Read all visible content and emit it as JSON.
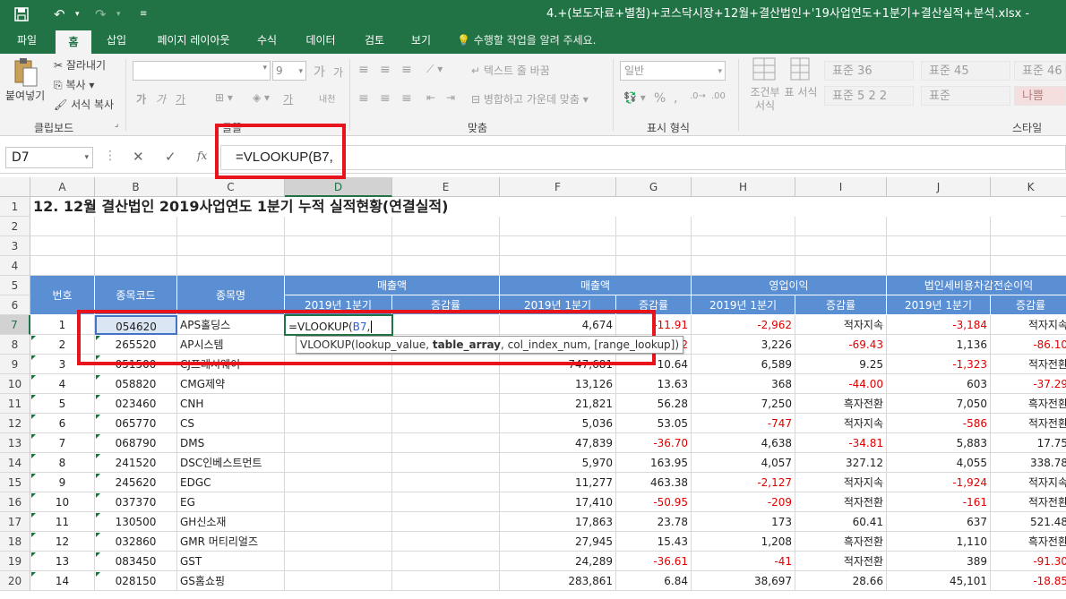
{
  "titlebar": {
    "save_icon": "save-icon",
    "undo_icon": "undo-icon",
    "redo_icon": "redo-icon",
    "customize_icon": "customize-qat-icon",
    "file_title": "4.+(보도자료+별첨)+코스닥시장+12월+결산법인+'19사업연도+1분기+결산실적+분석.xlsx -"
  },
  "tabs": [
    "파일",
    "홈",
    "삽입",
    "페이지 레이아웃",
    "수식",
    "데이터",
    "검토",
    "보기"
  ],
  "tell_me": "수행할 작업을 알려 주세요.",
  "ribbon": {
    "paste": "붙여넣기",
    "cut": "잘라내기",
    "copy": "복사",
    "format_painter": "서식 복사",
    "clipboard_group": "클립보드",
    "font_group": "글꼴",
    "font_size": "9",
    "bold": "가",
    "italic": "가",
    "underline": "가",
    "increase_font": "가",
    "decrease_font": "가",
    "font_color": "가",
    "phonetic": "내천",
    "wrap_text": "텍스트 줄 바꿈",
    "merge_center": "병합하고 가운데 맞춤",
    "alignment_group": "맞춤",
    "number_format": "일반",
    "percent": "%",
    "comma": ",",
    "number_group": "표시 형식",
    "conditional": "조건부 서식",
    "format_as_table": "표 서식",
    "styles": [
      "표준 36",
      "표준 45",
      "표준 46",
      "표준 5 2 2",
      "표준",
      "나쁨"
    ],
    "styles_group": "스타일"
  },
  "formula_bar": {
    "name_box": "D7",
    "cancel": "✕",
    "enter": "✓",
    "fx": "fx",
    "formula": "=VLOOKUP(B7,"
  },
  "columns": [
    "A",
    "B",
    "C",
    "D",
    "E",
    "F",
    "G",
    "H",
    "I",
    "J",
    "K"
  ],
  "row_numbers": [
    "1",
    "2",
    "3",
    "4",
    "5",
    "6",
    "7",
    "8",
    "9",
    "10",
    "11",
    "12",
    "13",
    "14",
    "15",
    "16",
    "17",
    "18",
    "19",
    "20"
  ],
  "sheet_title": "12. 12월 결산법인 2019사업연도 1분기 누적 실적현황(연결실적)",
  "headers": {
    "no": "번호",
    "code": "종목코드",
    "name": "종목명",
    "sales_d": "매출액",
    "sales_f": "매출액",
    "op_income": "영업이익",
    "net_income": "법인세비용차감전순이익",
    "q1_2019_d": "2019년 1분기",
    "change_e": "증감률",
    "q1_2019_f": "2019년 1분기",
    "change_g": "증감률",
    "q1_2019_h": "2019년 1분기",
    "change_i": "증감률",
    "q1_2019_j": "2019년 1분기",
    "change_k": "증감률"
  },
  "rows": [
    {
      "no": "1",
      "code": "054620",
      "name": "APS홀딩스",
      "sales": "4,674",
      "sales_chg": "-11.91",
      "op": "-2,962",
      "op_chg": "적자지속",
      "net": "-3,184",
      "net_chg": "적자지속"
    },
    {
      "no": "2",
      "code": "265520",
      "name": "AP시스템",
      "sales": "",
      "sales_chg": "-40.82",
      "op": "3,226",
      "op_chg": "-69.43",
      "net": "1,136",
      "net_chg": "-86.10"
    },
    {
      "no": "3",
      "code": "051500",
      "name": "CJ프레시웨이",
      "sales": "747,681",
      "sales_chg": "10.64",
      "op": "6,589",
      "op_chg": "9.25",
      "net": "-1,323",
      "net_chg": "적자전환"
    },
    {
      "no": "4",
      "code": "058820",
      "name": "CMG제약",
      "sales": "13,126",
      "sales_chg": "13.63",
      "op": "368",
      "op_chg": "-44.00",
      "net": "603",
      "net_chg": "-37.29"
    },
    {
      "no": "5",
      "code": "023460",
      "name": "CNH",
      "sales": "21,821",
      "sales_chg": "56.28",
      "op": "7,250",
      "op_chg": "흑자전환",
      "net": "7,050",
      "net_chg": "흑자전환"
    },
    {
      "no": "6",
      "code": "065770",
      "name": "CS",
      "sales": "5,036",
      "sales_chg": "53.05",
      "op": "-747",
      "op_chg": "적자지속",
      "net": "-586",
      "net_chg": "적자전환"
    },
    {
      "no": "7",
      "code": "068790",
      "name": "DMS",
      "sales": "47,839",
      "sales_chg": "-36.70",
      "op": "4,638",
      "op_chg": "-34.81",
      "net": "5,883",
      "net_chg": "17.75"
    },
    {
      "no": "8",
      "code": "241520",
      "name": "DSC인베스트먼트",
      "sales": "5,970",
      "sales_chg": "163.95",
      "op": "4,057",
      "op_chg": "327.12",
      "net": "4,055",
      "net_chg": "338.78"
    },
    {
      "no": "9",
      "code": "245620",
      "name": "EDGC",
      "sales": "11,277",
      "sales_chg": "463.38",
      "op": "-2,127",
      "op_chg": "적자지속",
      "net": "-1,924",
      "net_chg": "적자지속"
    },
    {
      "no": "10",
      "code": "037370",
      "name": "EG",
      "sales": "17,410",
      "sales_chg": "-50.95",
      "op": "-209",
      "op_chg": "적자전환",
      "net": "-161",
      "net_chg": "적자전환"
    },
    {
      "no": "11",
      "code": "130500",
      "name": "GH신소재",
      "sales": "17,863",
      "sales_chg": "23.78",
      "op": "173",
      "op_chg": "60.41",
      "net": "637",
      "net_chg": "521.48"
    },
    {
      "no": "12",
      "code": "032860",
      "name": "GMR 머티리얼즈",
      "sales": "27,945",
      "sales_chg": "15.43",
      "op": "1,208",
      "op_chg": "흑자전환",
      "net": "1,110",
      "net_chg": "흑자전환"
    },
    {
      "no": "13",
      "code": "083450",
      "name": "GST",
      "sales": "24,289",
      "sales_chg": "-36.61",
      "op": "-41",
      "op_chg": "적자전환",
      "net": "389",
      "net_chg": "-91.30"
    },
    {
      "no": "14",
      "code": "028150",
      "name": "GS홈쇼핑",
      "sales": "283,861",
      "sales_chg": "6.84",
      "op": "38,697",
      "op_chg": "28.66",
      "net": "45,101",
      "net_chg": "-18.85"
    }
  ],
  "edit_cell": {
    "prefix": "=VLOOKUP(",
    "ref": "B7",
    "suffix": ","
  },
  "tooltip": {
    "fn": "VLOOKUP(",
    "arg1": "lookup_value, ",
    "arg2": "table_array",
    "rest": ", col_index_num, [range_lookup])"
  },
  "colors": {
    "accent": "#217346",
    "header_fill": "#5b8fd4",
    "negative": "#e00000",
    "highlight": "#e8141b"
  }
}
